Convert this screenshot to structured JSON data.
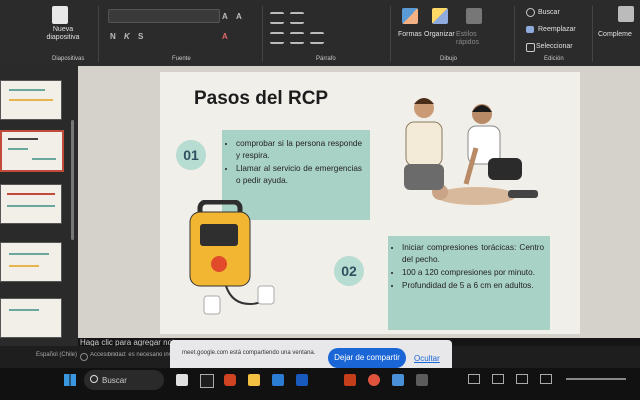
{
  "ribbon": {
    "new_slide_label": "Nueva diapositiva",
    "groups": {
      "slides": "Diapositivas",
      "font": "Fuente",
      "paragraph": "Párrafo",
      "drawing": "Dibujo",
      "editing": "Edición"
    },
    "shapes_label": "Formas",
    "arrange_label": "Organizar",
    "quick_styles_label": "Estilos rápidos",
    "search_label": "Buscar",
    "replace_label": "Reemplazar",
    "select_label": "Seleccionar",
    "complements_label": "Compleme"
  },
  "slide": {
    "title": "Pasos del RCP",
    "step1": {
      "number": "01",
      "bullets": [
        "comprobar si la persona responde y respira.",
        "Llamar al servicio de emergencias o pedir ayuda."
      ]
    },
    "step2": {
      "number": "02",
      "bullets": [
        "Iniciar compresiones torácicas: Centro del pecho.",
        "100 a 120 compresiones por minuto.",
        "Profundidad de 5 a 6 cm en adultos."
      ]
    }
  },
  "notes_placeholder": "Haga clic para agregar nota",
  "status": {
    "language": "Español (Chile)",
    "accessibility": "Accesibilidad: es necesario investigar"
  },
  "share_bar": {
    "message": "meet.google.com está compartiendo una ventana.",
    "stop_button": "Dejar de compartir",
    "hide_link": "Ocultar"
  },
  "taskbar": {
    "search_label": "Buscar"
  },
  "colors": {
    "teal_box": "#a9d2c6",
    "accent_blue": "#1a66d6",
    "selected_thumb": "#c14b3a"
  }
}
